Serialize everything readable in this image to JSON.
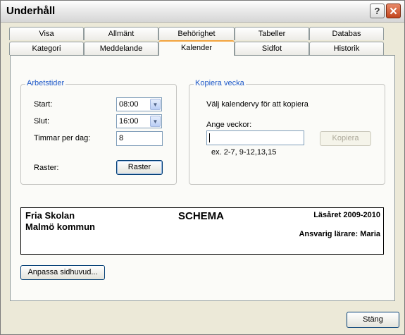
{
  "window": {
    "title": "Underhåll",
    "help_label": "?",
    "close_label": "✕"
  },
  "tabs": {
    "row1": [
      "Visa",
      "Allmänt",
      "Behörighet",
      "Tabeller",
      "Databas"
    ],
    "row2": [
      "Kategori",
      "Meddelande",
      "Kalender",
      "Sidfot",
      "Historik"
    ],
    "active": "Kalender"
  },
  "arbetstider": {
    "legend": "Arbetstider",
    "start_label": "Start:",
    "start_value": "08:00",
    "slut_label": "Slut:",
    "slut_value": "16:00",
    "timmar_label": "Timmar per dag:",
    "timmar_value": "8",
    "raster_label": "Raster:",
    "raster_button": "Raster"
  },
  "kopiera": {
    "legend": "Kopiera vecka",
    "instruction": "Välj kalendervy för att kopiera",
    "weeks_label": "Ange veckor:",
    "weeks_value": "",
    "example": "ex. 2-7, 9-12,13,15",
    "copy_button": "Kopiera"
  },
  "page_header": {
    "school": "Fria Skolan",
    "municipality": "Malmö kommun",
    "title": "SCHEMA",
    "year": "Läsåret 2009-2010",
    "teacher": "Ansvarig lärare: Maria"
  },
  "customize_button": "Anpassa sidhuvud...",
  "close_button": "Stäng"
}
